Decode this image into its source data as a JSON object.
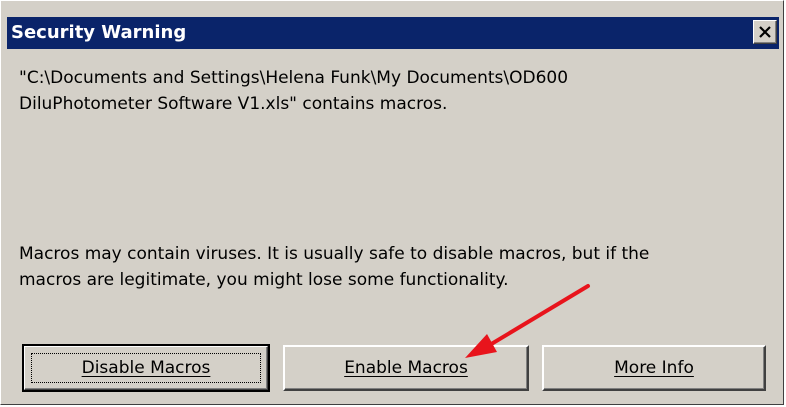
{
  "dialog": {
    "title": "Security Warning",
    "close_icon": "close-icon",
    "message_line1": "\"C:\\Documents and Settings\\Helena Funk\\My Documents\\OD600",
    "message_line2": "DiluPhotometer Software V1.xls\" contains macros.",
    "warning_line1": "Macros may contain viruses. It is usually safe to disable macros, but if the",
    "warning_line2": "macros are legitimate, you might lose some functionality."
  },
  "buttons": {
    "disable_label": "Disable Macros",
    "enable_label": "Enable Macros",
    "more_info_label": "More Info"
  },
  "annotation": {
    "arrow_color": "#e8141c",
    "icon": "red-arrow-icon"
  }
}
